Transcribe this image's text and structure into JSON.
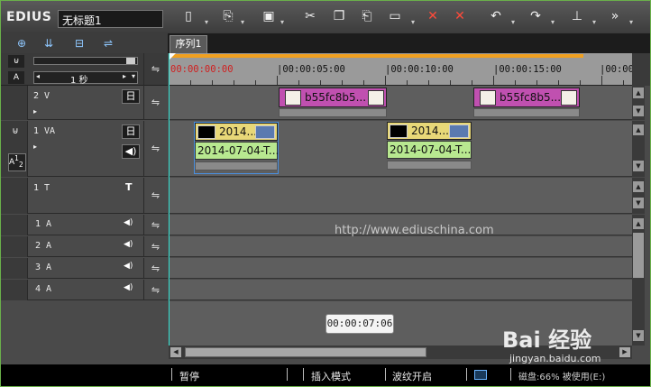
{
  "app": {
    "name": "EDIUS",
    "project_title": "无标题1"
  },
  "toolbar": {
    "icons": [
      "new-file-icon",
      "open-icon",
      "save-icon",
      "cut-icon",
      "copy-icon",
      "paste-icon",
      "clip-view-icon",
      "delete-icon",
      "ripple-delete-icon",
      "undo-icon",
      "redo-icon",
      "markers-icon",
      "more-icon"
    ]
  },
  "sequence_tab": {
    "label": "序列1"
  },
  "ruler": {
    "scale_label": "1 秒",
    "timecodes": [
      "00:00:00:00",
      "|00:00:05:00",
      "|00:00:10:00",
      "|00:00:15:00",
      "|00:00"
    ]
  },
  "tracks": {
    "v2": {
      "name": "2 V"
    },
    "va1": {
      "name": "1 VA",
      "side_label": "A",
      "side_sub": "1",
      "side_sub2": "2"
    },
    "t1": {
      "name": "1 T"
    },
    "audio": [
      {
        "name": "1 A"
      },
      {
        "name": "2 A"
      },
      {
        "name": "3 A"
      },
      {
        "name": "4 A"
      }
    ]
  },
  "clips": {
    "v2_a": {
      "label": "b55fc8b5..."
    },
    "v2_b": {
      "label": "b55fc8b5..."
    },
    "va1_a_video": {
      "label": "2014..."
    },
    "va1_a_audio": {
      "label": "2014-07-04-T..."
    },
    "va1_b_video": {
      "label": "2014..."
    },
    "va1_b_audio": {
      "label": "2014-07-04-T..."
    }
  },
  "watermark_url": "http://www.ediuschina.com",
  "tooltip": {
    "timecode": "00:00:07:06"
  },
  "status": {
    "pause": "暂停",
    "insert_mode": "插入模式",
    "ripple": "波纹开启",
    "disk": "磁盘:66% 被使用(E:)"
  },
  "baidu": {
    "logo": "Bai 经验",
    "sub": "jingyan.baidu.com"
  },
  "colors": {
    "accent_green": "#6ab04a",
    "clip_magenta": "#c050b0",
    "clip_yellow": "#e8d878",
    "clip_green": "#b8e890",
    "ruler_orange": "#f0a020"
  }
}
